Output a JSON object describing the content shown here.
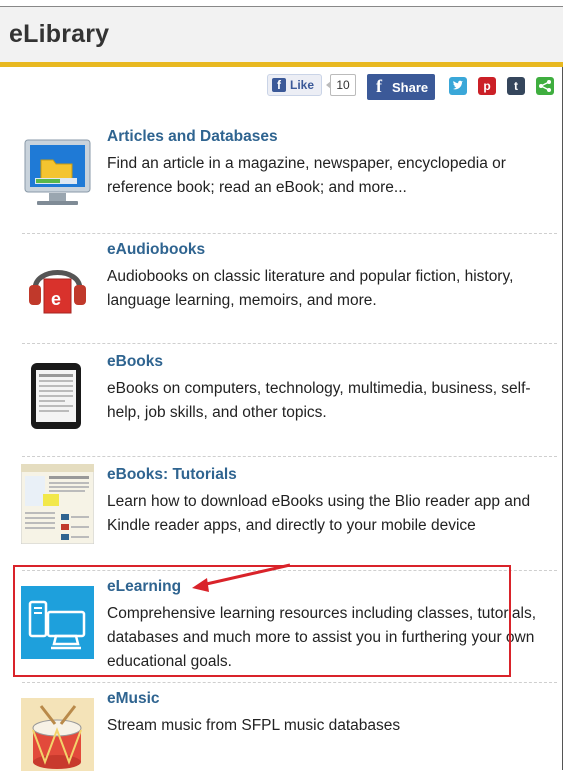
{
  "header": {
    "title": "eLibrary"
  },
  "social": {
    "like_label": "Like",
    "like_count": "10",
    "share_label": "Share",
    "fb_glyph": "f",
    "twitter_glyph": "t",
    "pinterest_glyph": "p",
    "tumblr_glyph": "t",
    "share_glyph": "<"
  },
  "items": [
    {
      "title": "Articles and Databases",
      "desc": "Find an article in a magazine, newspaper, encyclopedia or reference book; read an eBook; and more...",
      "icon": "computer-folder-icon"
    },
    {
      "title": "eAudiobooks",
      "desc": "Audiobooks on classic literature and popular fiction, history, language learning, memoirs, and more.",
      "icon": "headphones-book-icon"
    },
    {
      "title": "eBooks",
      "desc": "eBooks on computers, technology, multimedia, business, self-help, job skills, and other topics.",
      "icon": "tablet-icon"
    },
    {
      "title": "eBooks: Tutorials",
      "desc": "Learn how to download eBooks using the Blio reader app and Kindle reader apps, and directly to your mobile device",
      "icon": "tutorial-screenshot-icon"
    },
    {
      "title": "eLearning",
      "desc": "Comprehensive learning resources including classes, tutorials, databases and much more to assist you in furthering your own educational goals.",
      "icon": "devices-icon"
    },
    {
      "title": "eMusic",
      "desc": "Stream music from SFPL music databases",
      "icon": "drum-icon"
    }
  ],
  "colors": {
    "accent": "#e8b820",
    "link": "#2f6490",
    "highlight": "#d9232a"
  }
}
